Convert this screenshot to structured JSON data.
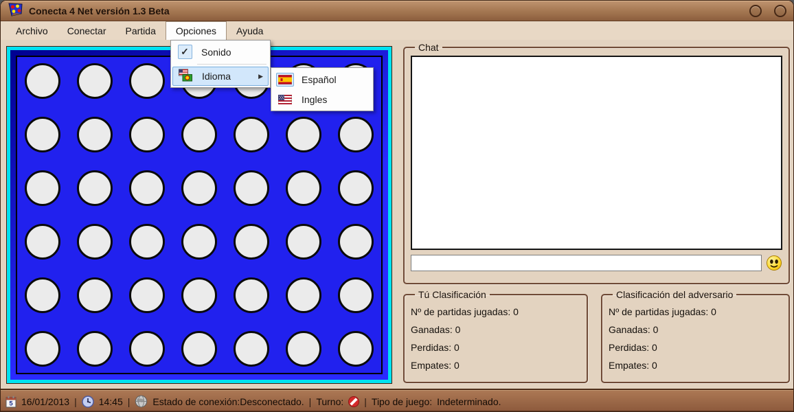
{
  "titlebar": {
    "title": "Conecta 4 Net versión 1.3 Beta",
    "app_icon": "connect4-board-icon",
    "buttons": [
      {
        "icon": "minimize-circle-icon"
      },
      {
        "icon": "close-circle-icon"
      }
    ]
  },
  "menubar": {
    "items": [
      {
        "label": "Archivo"
      },
      {
        "label": "Conectar"
      },
      {
        "label": "Partida"
      },
      {
        "label": "Opciones",
        "open": true
      },
      {
        "label": "Ayuda"
      }
    ]
  },
  "opciones_menu": {
    "items": [
      {
        "label": "Sonido",
        "checked": true,
        "icon": "checkmark-icon"
      },
      {
        "label": "Idioma",
        "has_submenu": true,
        "icon": "languages-icon",
        "highlighted": true
      }
    ],
    "submenu_arrow": "▶",
    "check_glyph": "✓"
  },
  "idioma_submenu": {
    "items": [
      {
        "label": "Español",
        "icon": "spain-flag-icon",
        "selected": true
      },
      {
        "label": "Ingles",
        "icon": "us-flag-icon"
      }
    ]
  },
  "board": {
    "rows": 6,
    "cols": 7,
    "cells_state": "empty",
    "colors": {
      "field_blue": "#2121ee",
      "hole_gray": "#ebebeb",
      "frame_cyan": "#00e2f2"
    }
  },
  "chat": {
    "legend": "Chat",
    "messages": "",
    "input_value": "",
    "send_button_icon": "smiley-icon"
  },
  "stats": {
    "you": {
      "legend": "Tú Clasificación",
      "lines": [
        "Nº de partidas jugadas: 0",
        "Ganadas: 0",
        "Perdidas: 0",
        "Empates: 0"
      ]
    },
    "opponent": {
      "legend": "Clasificación del adversario",
      "lines": [
        "Nº de partidas jugadas: 0",
        "Ganadas: 0",
        "Perdidas: 0",
        "Empates: 0"
      ]
    }
  },
  "statusbar": {
    "separator": "|",
    "date": "16/01/2013",
    "date_icon": "calendar-icon",
    "time": "14:45",
    "time_icon": "clock-icon",
    "connection": "Estado de conexión:Desconectado.",
    "connection_icon": "globe-icon",
    "turn_label": "Turno:",
    "turn_icon": "no-entry-icon",
    "game_type_label": "Tipo de juego:",
    "game_type_value": "Indeterminado."
  },
  "colors": {
    "titlebar_brown": "#a87b55",
    "background_tan": "#e3d3c0",
    "statusbar_brown": "#9a6747",
    "menu_highlight_blue": "#d2e7fb",
    "board_blue": "#2121ee",
    "board_cyan": "#00e2f2"
  }
}
